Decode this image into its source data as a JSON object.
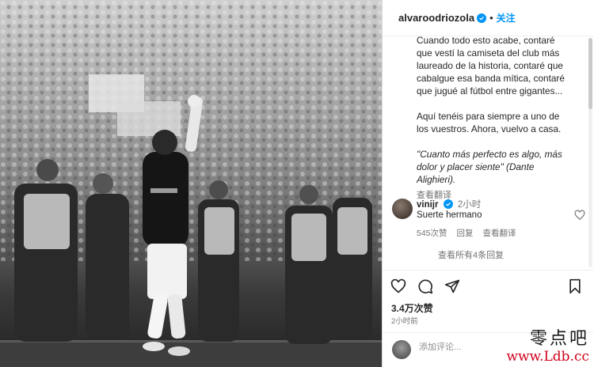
{
  "post": {
    "username": "alvaroodriozola",
    "follow_label": "关注",
    "separator": "•",
    "caption_lines": [
      "Cuando todo esto acabe, contaré",
      "que vestí la camiseta del club más",
      "laureado de la historia, contaré que",
      "cabalgue esa banda mítica, contaré",
      "que jugué al fútbol entre gigantes..."
    ],
    "caption_lines_2": [
      "Aquí tenéis para siempre a uno de",
      "los vuestros. Ahora, vuelvo a casa."
    ],
    "quote_lines": [
      "\"Cuanto más perfecto es algo, más",
      "dolor y placer siente\" (Dante",
      "Alighieri)."
    ],
    "translate_label": "查看翻译"
  },
  "comment": {
    "username": "vinijr",
    "time": "2小时",
    "text": "Suerte hermano",
    "likes": "545次赞",
    "reply_label": "回复",
    "translate_label": "查看翻译"
  },
  "view_all_label": "查看所有4条回复",
  "stats": {
    "likes": "3.4万次赞",
    "posted": "2小时前"
  },
  "add_comment": {
    "placeholder": "添加评论..."
  },
  "watermark": {
    "cn": "零点吧",
    "url": "www.Ldb.cc"
  },
  "colors": {
    "accent": "#0095f6",
    "text": "#262626",
    "muted": "#737373",
    "watermark_url": "#d0021b"
  }
}
